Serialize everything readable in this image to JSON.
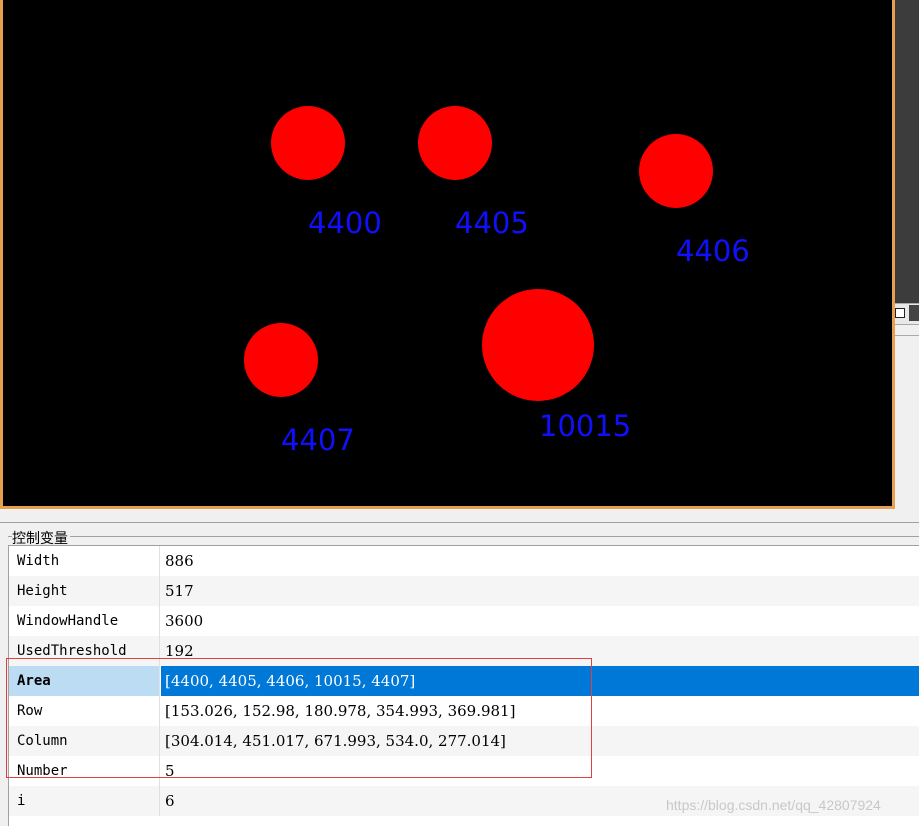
{
  "graphics": {
    "background": "#000000",
    "blob_color": "#ff0000",
    "label_color": "#1010ff",
    "border_color": "#e7a050",
    "blobs": [
      {
        "label": "4400"
      },
      {
        "label": "4405"
      },
      {
        "label": "4406"
      },
      {
        "label": "10015"
      },
      {
        "label": "4407"
      }
    ]
  },
  "panel": {
    "title": "控制变量",
    "variables": [
      {
        "name": "Width",
        "value": "886"
      },
      {
        "name": "Height",
        "value": "517"
      },
      {
        "name": "WindowHandle",
        "value": "3600"
      },
      {
        "name": "UsedThreshold",
        "value": "192"
      },
      {
        "name": "Area",
        "value": "[4400, 4405, 4406, 10015, 4407]",
        "selected": true
      },
      {
        "name": "Row",
        "value": "[153.026, 152.98, 180.978, 354.993, 369.981]"
      },
      {
        "name": "Column",
        "value": "[304.014, 451.017, 671.993, 534.0, 277.014]"
      },
      {
        "name": "Number",
        "value": "5"
      },
      {
        "name": "i",
        "value": "6"
      }
    ],
    "selected_color": "#0078d7",
    "highlight_color": "#e04040"
  },
  "watermark": "https://blog.csdn.net/qq_42807924"
}
